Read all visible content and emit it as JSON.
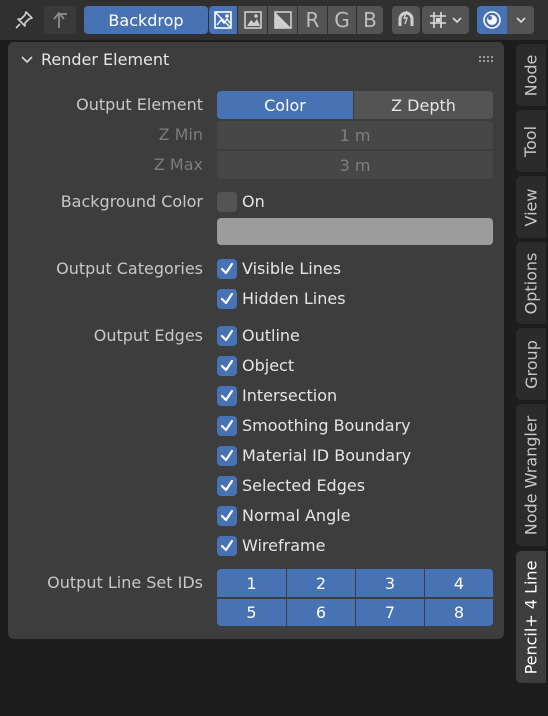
{
  "header": {
    "backdrop_label": "Backdrop",
    "channel_letters": [
      "R",
      "G",
      "B"
    ],
    "icons": [
      "pin-icon",
      "parent-node-icon",
      "backdrop-rgba-icon",
      "backdrop-image-icon",
      "backdrop-alpha-icon",
      "snap-magnet-icon",
      "snap-grid-icon",
      "overlay-icon",
      "chevron-down-icon"
    ]
  },
  "panel": {
    "title": "Render Element",
    "output_element": {
      "label": "Output Element",
      "options": [
        "Color",
        "Z Depth"
      ],
      "selected": "Color"
    },
    "z_min": {
      "label": "Z Min",
      "value": "1 m"
    },
    "z_max": {
      "label": "Z Max",
      "value": "3 m"
    },
    "background_color": {
      "label": "Background Color",
      "checkbox_label": "On",
      "checked": false,
      "swatch_color": "#9c9c9c"
    },
    "output_categories": {
      "label": "Output Categories",
      "items": [
        {
          "label": "Visible Lines",
          "checked": true
        },
        {
          "label": "Hidden Lines",
          "checked": true
        }
      ]
    },
    "output_edges": {
      "label": "Output Edges",
      "items": [
        {
          "label": "Outline",
          "checked": true
        },
        {
          "label": "Object",
          "checked": true
        },
        {
          "label": "Intersection",
          "checked": true
        },
        {
          "label": "Smoothing Boundary",
          "checked": true
        },
        {
          "label": "Material ID Boundary",
          "checked": true
        },
        {
          "label": "Selected Edges",
          "checked": true
        },
        {
          "label": "Normal Angle",
          "checked": true
        },
        {
          "label": "Wireframe",
          "checked": true
        }
      ]
    },
    "output_line_set_ids": {
      "label": "Output Line Set IDs",
      "ids": [
        "1",
        "2",
        "3",
        "4",
        "5",
        "6",
        "7",
        "8"
      ]
    }
  },
  "sidebar_tabs": [
    "Node",
    "Tool",
    "View",
    "Options",
    "Group",
    "Node Wrangler",
    "Pencil+ 4 Line"
  ],
  "active_tab": "Pencil+ 4 Line",
  "colors": {
    "accent": "#4772b3",
    "panel_bg": "#3d3d3d",
    "header_bg": "#303030"
  }
}
